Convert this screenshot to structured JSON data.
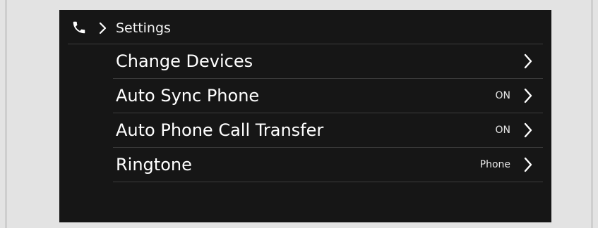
{
  "header": {
    "icon": "phone-icon",
    "chevron_icon": "chevron-right-icon",
    "title": "Settings"
  },
  "menu": {
    "items": [
      {
        "label": "Change Devices",
        "value": "",
        "chevron_icon": "chevron-right-icon"
      },
      {
        "label": "Auto Sync Phone",
        "value": "ON",
        "chevron_icon": "chevron-right-icon"
      },
      {
        "label": "Auto Phone Call Transfer",
        "value": "ON",
        "chevron_icon": "chevron-right-icon"
      },
      {
        "label": "Ringtone",
        "value": "Phone",
        "chevron_icon": "chevron-right-icon"
      }
    ]
  },
  "colors": {
    "screen_background": "#161616",
    "page_background": "#e3e3e3",
    "text": "#ffffff",
    "divider": "#3b3b3b"
  }
}
